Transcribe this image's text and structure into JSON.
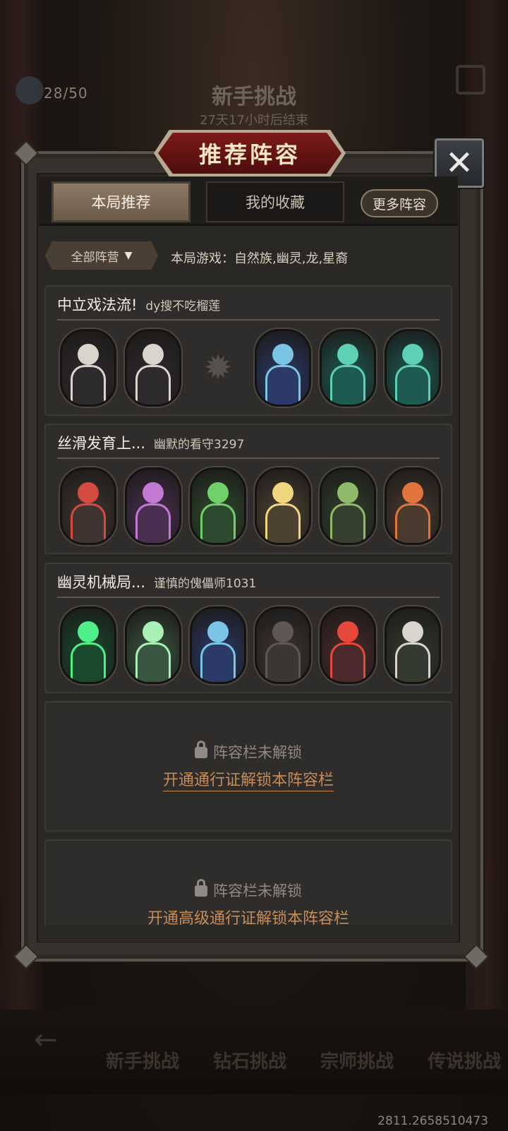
{
  "background": {
    "counter": "28/50",
    "title": "新手挑战",
    "timer": "27天17小时后结束",
    "nav_back": "←",
    "nav_tabs": [
      "新手挑战",
      "钻石挑战",
      "宗师挑战",
      "传说挑战"
    ],
    "coords": "2811.2658510473"
  },
  "modal": {
    "title": "推荐阵容",
    "close_symbol": "✕",
    "tabs": [
      "本局推荐",
      "我的收藏"
    ],
    "more_label": "更多阵容",
    "faction_filter": "全部阵营",
    "faction_arrow": "▼",
    "game_info": "本局游戏：自然族,幽灵,龙,星裔"
  },
  "lineups": [
    {
      "name": "中立戏法流!",
      "author": "dy搜不吃榴莲",
      "heroes": [
        "magician-icon",
        "magician-icon",
        "empty-slot-icon",
        "sorceress-icon",
        "water-spirit-icon",
        "water-spirit-icon"
      ],
      "colors": [
        "#2d2a2e",
        "#2d2a2e",
        "",
        "#2b3a66",
        "#1e5a52",
        "#1e5a52"
      ]
    },
    {
      "name": "丝滑发育上...",
      "author": "幽默的看守3297",
      "heroes": [
        "rose-elf-icon",
        "bunny-girl-icon",
        "flower-dryad-icon",
        "blonde-elf-icon",
        "cactus-icon",
        "flame-hair-icon"
      ],
      "colors": [
        "#3f3430",
        "#4a3050",
        "#2e4a2e",
        "#4d4232",
        "#32402d",
        "#4a3a2e"
      ]
    },
    {
      "name": "幽灵机械局...",
      "author": "谨慎的傀儡师1031",
      "heroes": [
        "green-ghost-warrior-icon",
        "ghost-cat-icon",
        "sorceress-icon",
        "hooded-mage-icon",
        "red-demon-icon",
        "reaper-icon"
      ],
      "colors": [
        "#1a4a2e",
        "#3a5540",
        "#2b3a66",
        "#3a3634",
        "#4a2a2a",
        "#343a2e"
      ]
    }
  ],
  "hero_accents": [
    [
      "#d9d4cc",
      "#d9d4cc",
      "",
      "#7ac5e6",
      "#5ed0b5",
      "#5ed0b5"
    ],
    [
      "#d44a3e",
      "#c27ad4",
      "#6fcf6a",
      "#f1d680",
      "#8fba6a",
      "#e2733d"
    ],
    [
      "#4ff08a",
      "#a8f0b6",
      "#7ac5e6",
      "#5e5753",
      "#e6483c",
      "#d9d4cc"
    ]
  ],
  "locked_slots": [
    {
      "status": "阵容栏未解锁",
      "action": "开通通行证解锁本阵容栏"
    },
    {
      "status": "阵容栏未解锁",
      "action": "开通高级通行证解锁本阵容栏"
    }
  ]
}
